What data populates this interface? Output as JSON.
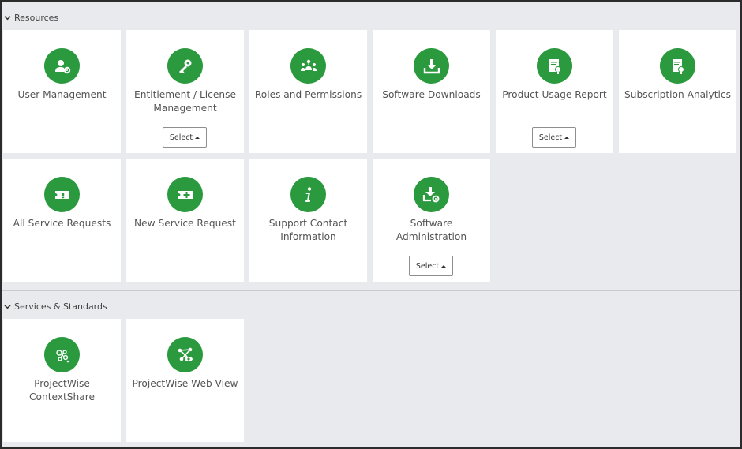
{
  "sections": [
    {
      "title": "Resources",
      "tiles": [
        {
          "label": "User Management",
          "icon": "user-gear-icon"
        },
        {
          "label": "Entitlement / License Management",
          "icon": "key-gear-icon",
          "select": "Select"
        },
        {
          "label": "Roles and Permissions",
          "icon": "people-network-icon"
        },
        {
          "label": "Software Downloads",
          "icon": "download-icon"
        },
        {
          "label": "Product Usage Report",
          "icon": "report-badge-icon",
          "select": "Select"
        },
        {
          "label": "Subscription Analytics",
          "icon": "analytics-badge-icon"
        },
        {
          "label": "All Service Requests",
          "icon": "ticket-alert-icon"
        },
        {
          "label": "New Service Request",
          "icon": "ticket-add-icon"
        },
        {
          "label": "Support Contact Information",
          "icon": "info-icon"
        },
        {
          "label": "Software Administration",
          "icon": "download-gear-icon",
          "select": "Select"
        }
      ]
    },
    {
      "title": "Services & Standards",
      "tiles": [
        {
          "label": "ProjectWise ContextShare",
          "icon": "contextshare-icon"
        },
        {
          "label": "ProjectWise Web View",
          "icon": "web-view-icon"
        }
      ]
    }
  ],
  "colors": {
    "accent": "#2b9a3f",
    "background": "#e9eaed",
    "tile": "#ffffff"
  }
}
